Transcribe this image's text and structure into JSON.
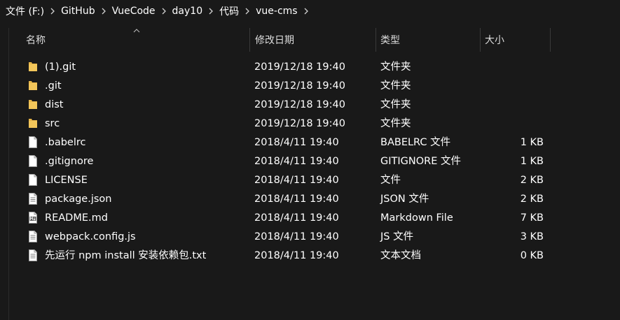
{
  "breadcrumb": [
    {
      "label": "文件 (F:)"
    },
    {
      "label": "GitHub"
    },
    {
      "label": "VueCode"
    },
    {
      "label": "day10"
    },
    {
      "label": "代码"
    },
    {
      "label": "vue-cms"
    }
  ],
  "columns": {
    "name": "名称",
    "date": "修改日期",
    "type": "类型",
    "size": "大小"
  },
  "files": [
    {
      "icon": "folder-icon",
      "name": "(1).git",
      "date": "2019/12/18 19:40",
      "type": "文件夹",
      "size": ""
    },
    {
      "icon": "folder-icon",
      "name": ".git",
      "date": "2019/12/18 19:40",
      "type": "文件夹",
      "size": ""
    },
    {
      "icon": "folder-icon",
      "name": "dist",
      "date": "2019/12/18 19:40",
      "type": "文件夹",
      "size": ""
    },
    {
      "icon": "folder-icon",
      "name": "src",
      "date": "2019/12/18 19:40",
      "type": "文件夹",
      "size": ""
    },
    {
      "icon": "file-icon",
      "name": ".babelrc",
      "date": "2018/4/11 19:40",
      "type": "BABELRC 文件",
      "size": "1 KB"
    },
    {
      "icon": "file-icon",
      "name": ".gitignore",
      "date": "2018/4/11 19:40",
      "type": "GITIGNORE 文件",
      "size": "1 KB"
    },
    {
      "icon": "file-icon",
      "name": "LICENSE",
      "date": "2018/4/11 19:40",
      "type": "文件",
      "size": "2 KB"
    },
    {
      "icon": "text-file-icon",
      "name": "package.json",
      "date": "2018/4/11 19:40",
      "type": "JSON 文件",
      "size": "2 KB"
    },
    {
      "icon": "markdown-file-icon",
      "name": "README.md",
      "date": "2018/4/11 19:40",
      "type": "Markdown File",
      "size": "7 KB"
    },
    {
      "icon": "text-file-icon",
      "name": "webpack.config.js",
      "date": "2018/4/11 19:40",
      "type": "JS 文件",
      "size": "3 KB"
    },
    {
      "icon": "text-file-icon",
      "name": "先运行 npm install 安装依赖包.txt",
      "date": "2018/4/11 19:40",
      "type": "文本文档",
      "size": "0 KB"
    }
  ],
  "colors": {
    "background": "#191919",
    "folder": "#e8b649",
    "text": "#ffffff"
  }
}
